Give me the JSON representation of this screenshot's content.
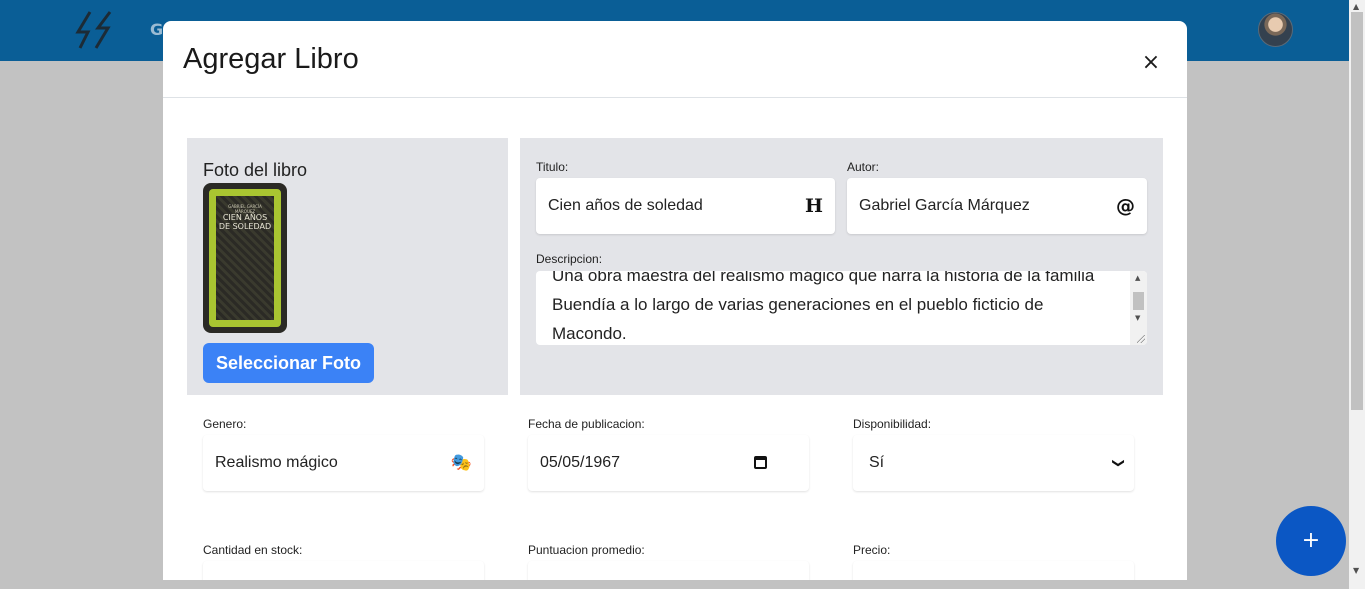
{
  "topbar": {
    "partial_text": "G"
  },
  "modal": {
    "title": "Agregar Libro",
    "close_label": "×"
  },
  "photo": {
    "label": "Foto del libro",
    "cover_title": "CIEN AÑOS DE SOLEDAD",
    "cover_author": "GABRIEL GARCÍA MÁRQUEZ",
    "select_button": "Seleccionar Foto"
  },
  "fields": {
    "titulo": {
      "label": "Titulo:",
      "value": "Cien años de soledad",
      "icon": "heading-icon",
      "glyph": "H"
    },
    "autor": {
      "label": "Autor:",
      "value": "Gabriel García Márquez",
      "icon": "at-icon",
      "glyph": "@"
    },
    "descripcion": {
      "label": "Descripcion:",
      "value": "Una obra maestra del realismo mágico que narra la historia de la familia Buendía a lo largo de varias generaciones en el pueblo ficticio de Macondo."
    },
    "genero": {
      "label": "Genero:",
      "value": "Realismo mágico",
      "icon": "theater-masks-icon",
      "glyph": "🎭"
    },
    "fecha": {
      "label": "Fecha de publicacion:",
      "value": "05/05/1967",
      "icon": "calendar-icon"
    },
    "disponibilidad": {
      "label": "Disponibilidad:",
      "value": "Sí",
      "icon": "chevron-down-icon",
      "glyph": "❯"
    },
    "stock": {
      "label": "Cantidad en stock:"
    },
    "puntuacion": {
      "label": "Puntuacion promedio:"
    },
    "precio": {
      "label": "Precio:"
    }
  },
  "fab": {
    "label": "+"
  },
  "colors": {
    "topbar": "#0a5e96",
    "primary_button": "#3b82f6",
    "fab": "#0b57c4",
    "panel": "#e3e4e8",
    "overlay": "#c2c2c2"
  }
}
